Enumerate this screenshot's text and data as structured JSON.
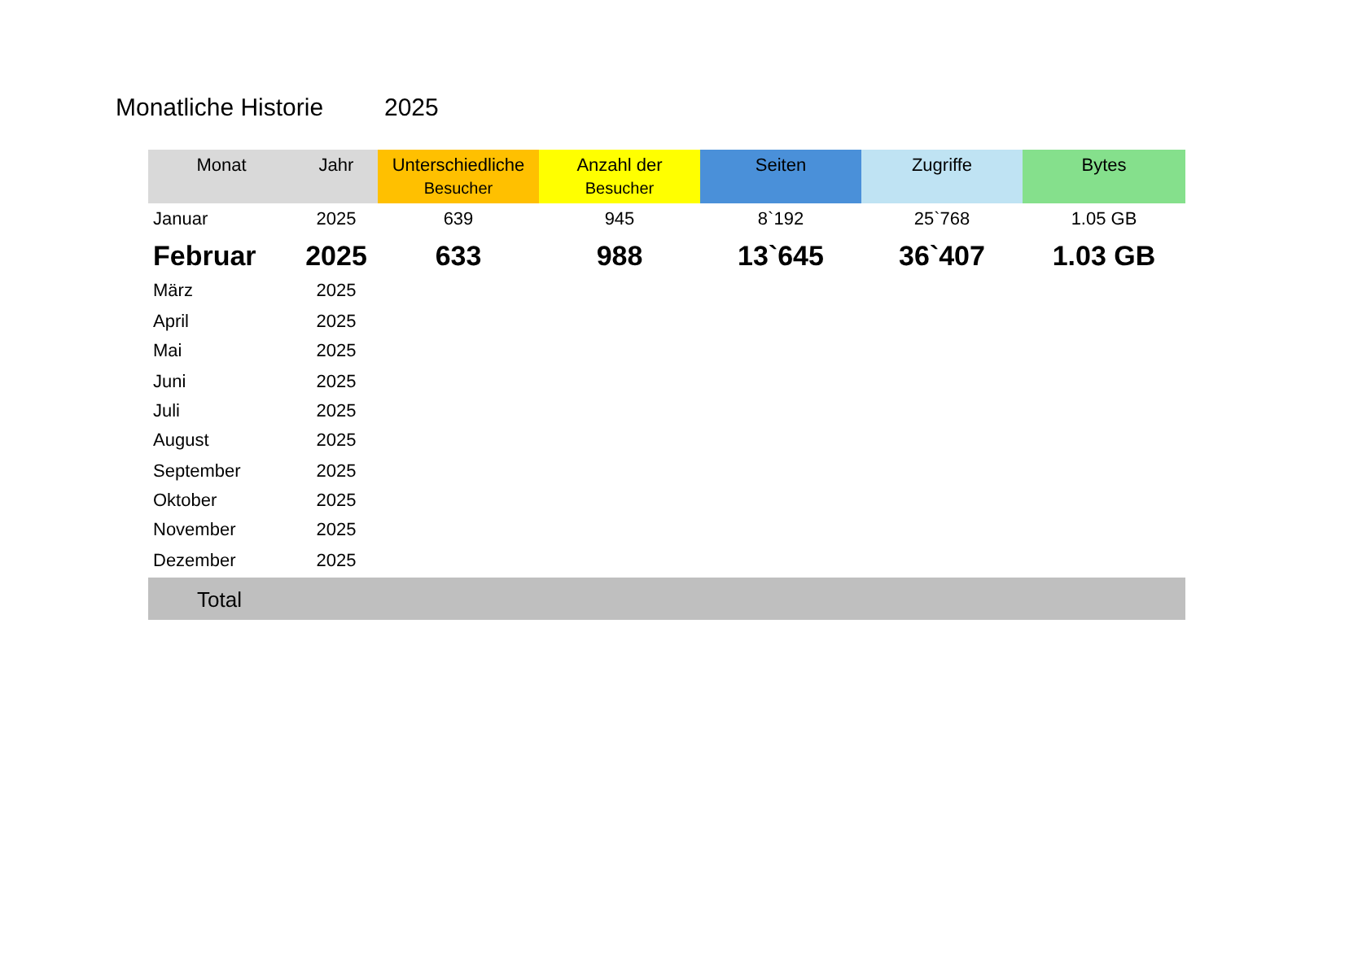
{
  "title": "Monatliche Historie",
  "year": "2025",
  "table": {
    "columns": [
      {
        "label": "Monat",
        "color": "#d9d9d9"
      },
      {
        "label": "Jahr",
        "color": "#d9d9d9"
      },
      {
        "label": "Unterschiedliche",
        "sublabel": "Besucher",
        "color": "#ffc000"
      },
      {
        "label": "Anzahl der",
        "sublabel": "Besucher",
        "color": "#ffff00"
      },
      {
        "label": "Seiten",
        "color": "#4a90d9"
      },
      {
        "label": "Zugriffe",
        "color": "#bfe3f3"
      },
      {
        "label": "Bytes",
        "color": "#85e08c"
      }
    ],
    "rows": [
      {
        "month": "Januar",
        "year": "2025",
        "selected": false,
        "values": [
          "639",
          "945",
          "8`192",
          "25`768",
          "1.05 GB"
        ]
      },
      {
        "month": "Februar",
        "year": "2025",
        "selected": true,
        "values": [
          "633",
          "988",
          "13`645",
          "36`407",
          "1.03 GB"
        ]
      },
      {
        "month": "März",
        "year": "2025",
        "selected": false
      },
      {
        "month": "April",
        "year": "2025",
        "selected": false
      },
      {
        "month": "Mai",
        "year": "2025",
        "selected": false
      },
      {
        "month": "Juni",
        "year": "2025",
        "selected": false
      },
      {
        "month": "Juli",
        "year": "2025",
        "selected": false
      },
      {
        "month": "August",
        "year": "2025",
        "selected": false
      },
      {
        "month": "September",
        "year": "2025",
        "selected": false
      },
      {
        "month": "Oktober",
        "year": "2025",
        "selected": false
      },
      {
        "month": "November",
        "year": "2025",
        "selected": false
      },
      {
        "month": "Dezember",
        "year": "2025",
        "selected": false
      }
    ],
    "total": {
      "label": "Total"
    }
  }
}
